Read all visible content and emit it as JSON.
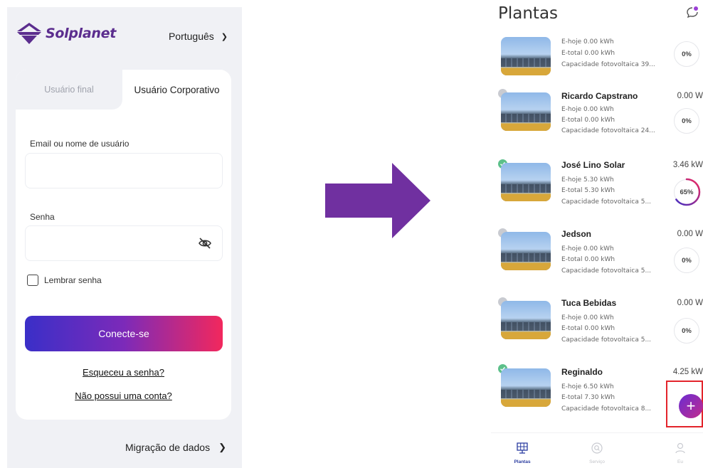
{
  "login": {
    "brand": "Solplanet",
    "language": "Português",
    "tabs": {
      "end_user": "Usuário final",
      "corporate": "Usuário Corporativo"
    },
    "email_label": "Email ou nome de usuário",
    "password_label": "Senha",
    "remember_label": "Lembrar senha",
    "login_button": "Conecte-se",
    "forgot_link": "Esqueceu a senha?",
    "no_account_link": "Não possui uma conta?",
    "migration": "Migração de dados"
  },
  "plants": {
    "title": "Plantas",
    "items": [
      {
        "name": "",
        "today": "E-hoje 0.00 kWh",
        "total": "E-total 0.00 kWh",
        "capacity": "Capacidade fotovoltaica 39...",
        "power": "",
        "percent": "0%",
        "percent_value": 0,
        "status": "none"
      },
      {
        "name": "Ricardo Capstrano",
        "today": "E-hoje 0.00 kWh",
        "total": "E-total 0.00 kWh",
        "capacity": "Capacidade fotovoltaica 24...",
        "power": "0.00 W",
        "percent": "0%",
        "percent_value": 0,
        "status": "offline"
      },
      {
        "name": "José Lino Solar",
        "today": "E-hoje 5.30 kWh",
        "total": "E-total 5.30 kWh",
        "capacity": "Capacidade fotovoltaica 5...",
        "power": "3.46 kW",
        "percent": "65%",
        "percent_value": 65,
        "status": "online"
      },
      {
        "name": "Jedson",
        "today": "E-hoje 0.00 kWh",
        "total": "E-total 0.00 kWh",
        "capacity": "Capacidade fotovoltaica 5...",
        "power": "0.00 W",
        "percent": "0%",
        "percent_value": 0,
        "status": "offline"
      },
      {
        "name": "Tuca Bebidas",
        "today": "E-hoje 0.00 kWh",
        "total": "E-total 0.00 kWh",
        "capacity": "Capacidade fotovoltaica 5...",
        "power": "0.00 W",
        "percent": "0%",
        "percent_value": 0,
        "status": "offline"
      },
      {
        "name": "Reginaldo",
        "today": "E-hoje 6.50 kWh",
        "total": "E-total 7.30 kWh",
        "capacity": "Capacidade fotovoltaica 8...",
        "power": "4.25 kW",
        "percent": "",
        "percent_value": null,
        "status": "online"
      }
    ],
    "tabbar": [
      {
        "label": "Plantas",
        "icon": "solar-panel-icon",
        "active": true
      },
      {
        "label": "Serviço",
        "icon": "service-icon",
        "active": false
      },
      {
        "label": "Eu",
        "icon": "user-icon",
        "active": false
      }
    ],
    "add_button": "+"
  },
  "colors": {
    "brand_purple": "#5b2d8e",
    "gradient_start": "#3a2fc8",
    "gradient_end": "#f2285d",
    "arrow_purple": "#7030a0",
    "online_green": "#5cc08a",
    "highlight_red": "#e3242b"
  }
}
